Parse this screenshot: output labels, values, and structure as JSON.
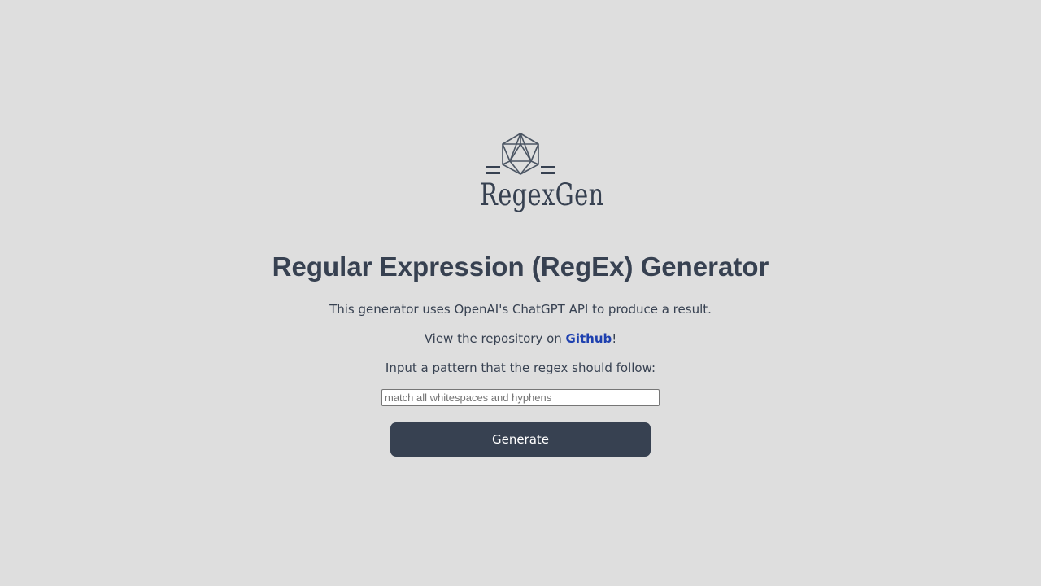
{
  "logo": {
    "icon": "icosahedron-icon",
    "wordmark": "RegexGen"
  },
  "header": {
    "title": "Regular Expression (RegEx) Generator"
  },
  "description": {
    "line1": "This generator uses OpenAI's ChatGPT API to produce a result.",
    "repo_prefix": "View the repository on ",
    "repo_link": "Github",
    "repo_suffix": "!",
    "prompt_label": "Input a pattern that the regex should follow:"
  },
  "form": {
    "pattern_value": "",
    "pattern_placeholder": "match all whitespaces and hyphens",
    "generate_label": "Generate"
  },
  "colors": {
    "background": "#dedede",
    "text": "#374151",
    "link": "#1e40af",
    "button": "#374151"
  }
}
